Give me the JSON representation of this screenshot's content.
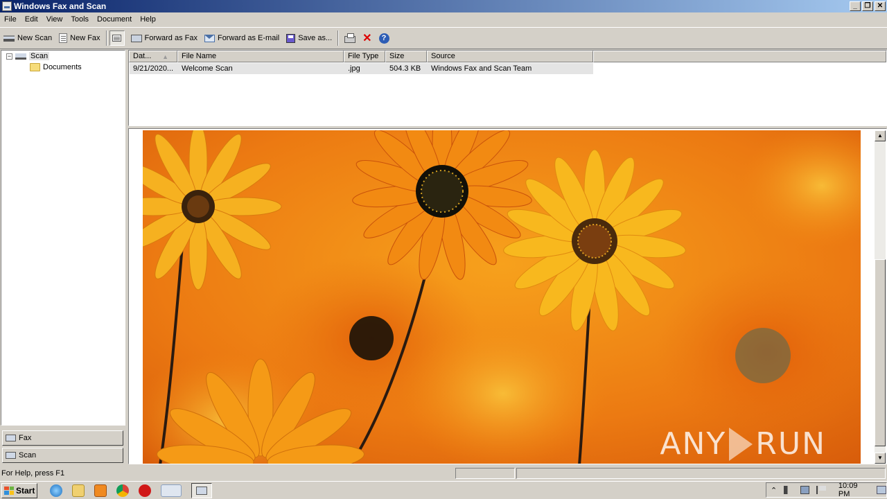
{
  "window": {
    "title": "Windows Fax and Scan",
    "buttons": {
      "minimize": "_",
      "restore": "❐",
      "close": "✕"
    }
  },
  "menu": [
    "File",
    "Edit",
    "View",
    "Tools",
    "Document",
    "Help"
  ],
  "toolbar": {
    "new_scan": "New Scan",
    "new_fax": "New Fax",
    "forward_fax": "Forward as Fax",
    "forward_email": "Forward as E-mail",
    "save_as": "Save as...",
    "help_glyph": "?",
    "delete_glyph": "✕"
  },
  "tree": {
    "root": "Scan",
    "root_expander": "−",
    "child": "Documents"
  },
  "nav_buttons": [
    "Fax",
    "Scan"
  ],
  "list": {
    "columns": [
      "Dat...",
      "File Name",
      "File Type",
      "Size",
      "Source"
    ],
    "sort_indicator": "▲",
    "rows": [
      {
        "date": "9/21/2020...",
        "file_name": "Welcome Scan",
        "file_type": ".jpg",
        "size": "504.3 KB",
        "source": "Windows Fax and Scan Team"
      }
    ]
  },
  "preview": {
    "watermark": "ANY RUN",
    "watermark_left": "ANY",
    "watermark_right": "RUN",
    "scroll_up": "▲",
    "scroll_down": "▼"
  },
  "status": {
    "help_text": "For Help, press F1"
  },
  "taskbar": {
    "start_label": "Start",
    "clock": "10:09 PM",
    "tray_arrow": "⌃"
  },
  "colors": {
    "titlebar_start": "#0a246a",
    "titlebar_end": "#a6caf0",
    "chrome": "#d4d0c8",
    "petal_orange": "#f08a10",
    "petal_yellow": "#f9b21a"
  }
}
